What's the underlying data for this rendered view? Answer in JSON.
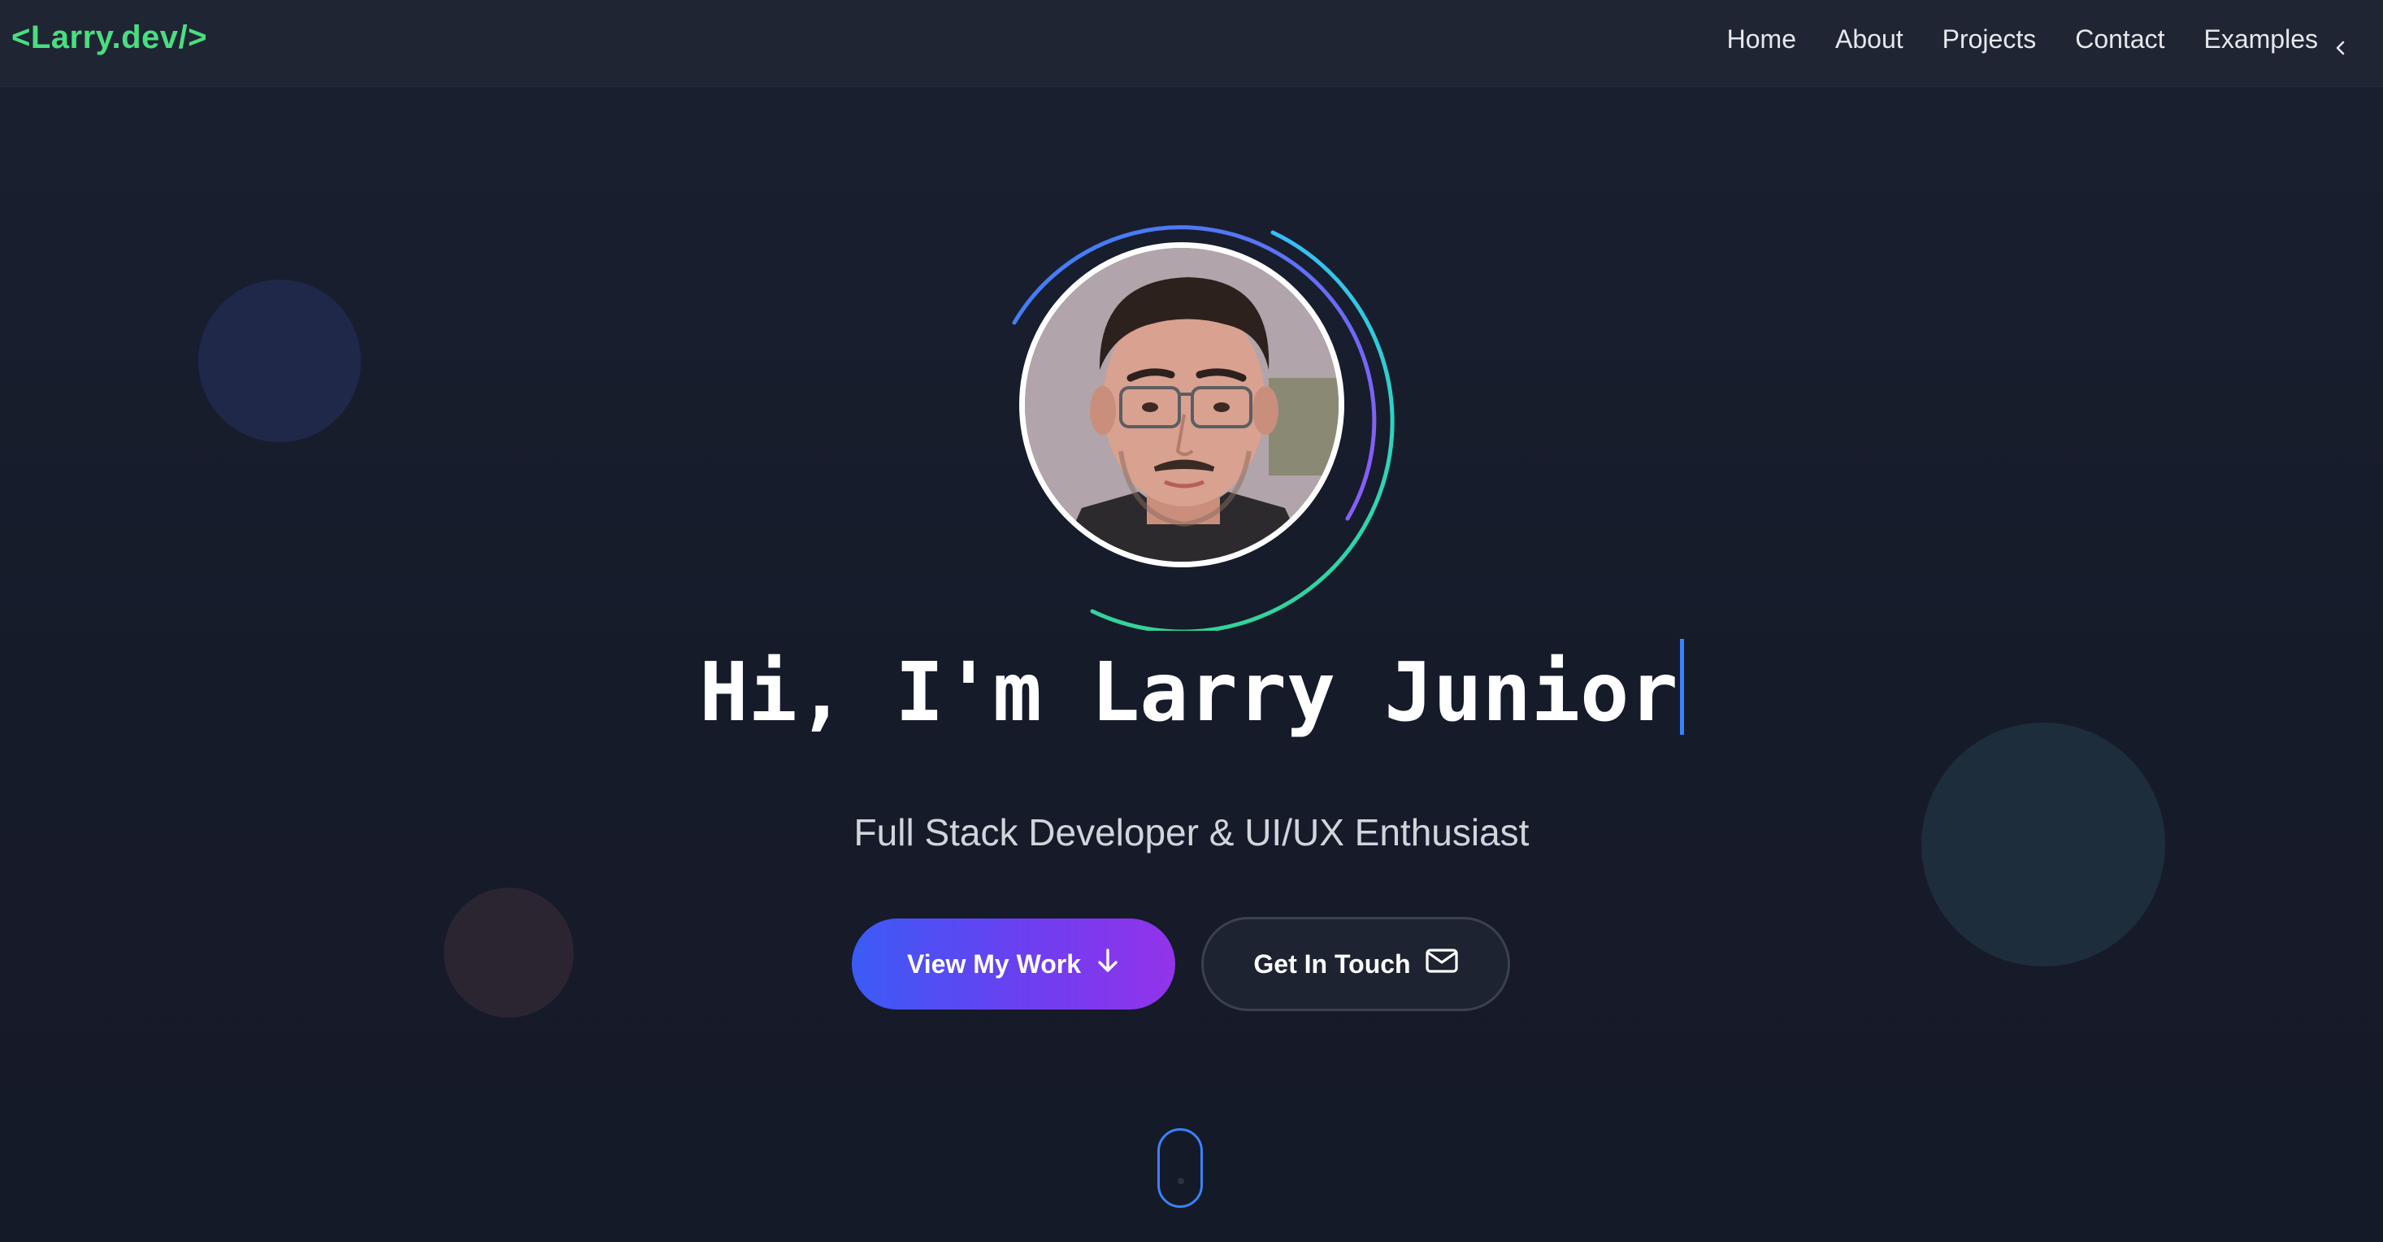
{
  "brand": {
    "logo_text": "<Larry.dev/>",
    "accent_color": "#4ade80"
  },
  "nav": {
    "items": [
      {
        "label": "Home"
      },
      {
        "label": "About"
      },
      {
        "label": "Projects"
      },
      {
        "label": "Contact"
      },
      {
        "label": "Examples",
        "icon": "chevron-left-icon"
      }
    ]
  },
  "hero": {
    "avatar_alt": "profile-photo",
    "headline": "Hi, I'm Larry Junior",
    "subtitle": "Full Stack Developer & UI/UX Enthusiast",
    "primary_button": {
      "label": "View My Work",
      "icon": "arrow-down-icon"
    },
    "secondary_button": {
      "label": "Get In Touch",
      "icon": "mail-icon"
    }
  },
  "colors": {
    "background": "#171c2b",
    "navbar": "#1f2533",
    "primary_gradient_start": "#3b5bf6",
    "primary_gradient_end": "#9333ea",
    "caret": "#3b82f6"
  }
}
